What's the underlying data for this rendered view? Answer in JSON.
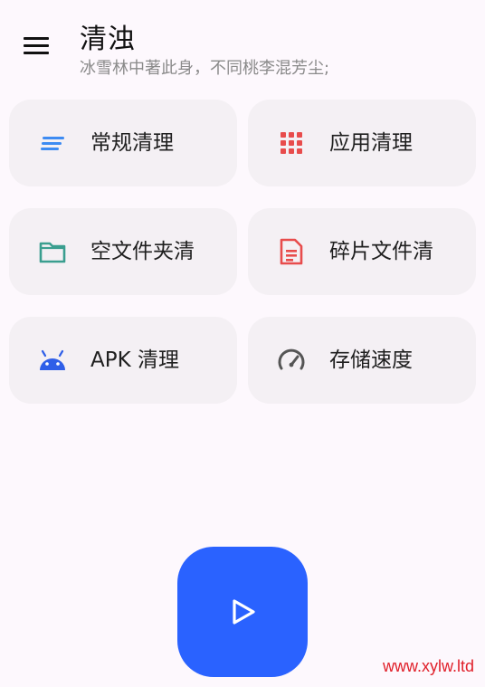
{
  "header": {
    "title": "清浊",
    "subtitle": "冰雪林中著此身，不同桃李混芳尘;"
  },
  "cards": [
    {
      "label": "常规清理",
      "icon": "short-text-icon",
      "color": "#3d8bf2"
    },
    {
      "label": "应用清理",
      "icon": "apps-grid-icon",
      "color": "#e84c4c"
    },
    {
      "label": "空文件夹清",
      "icon": "folder-icon",
      "color": "#3a9e8f"
    },
    {
      "label": "碎片文件清",
      "icon": "document-icon",
      "color": "#e84c4c"
    },
    {
      "label": "APK 清理",
      "icon": "android-icon",
      "color": "#2f5fe8"
    },
    {
      "label": "存储速度",
      "icon": "speedometer-icon",
      "color": "#555555"
    }
  ],
  "fab": {
    "icon": "play-icon",
    "color": "#2a62ff"
  },
  "watermark": "www.xylw.ltd"
}
